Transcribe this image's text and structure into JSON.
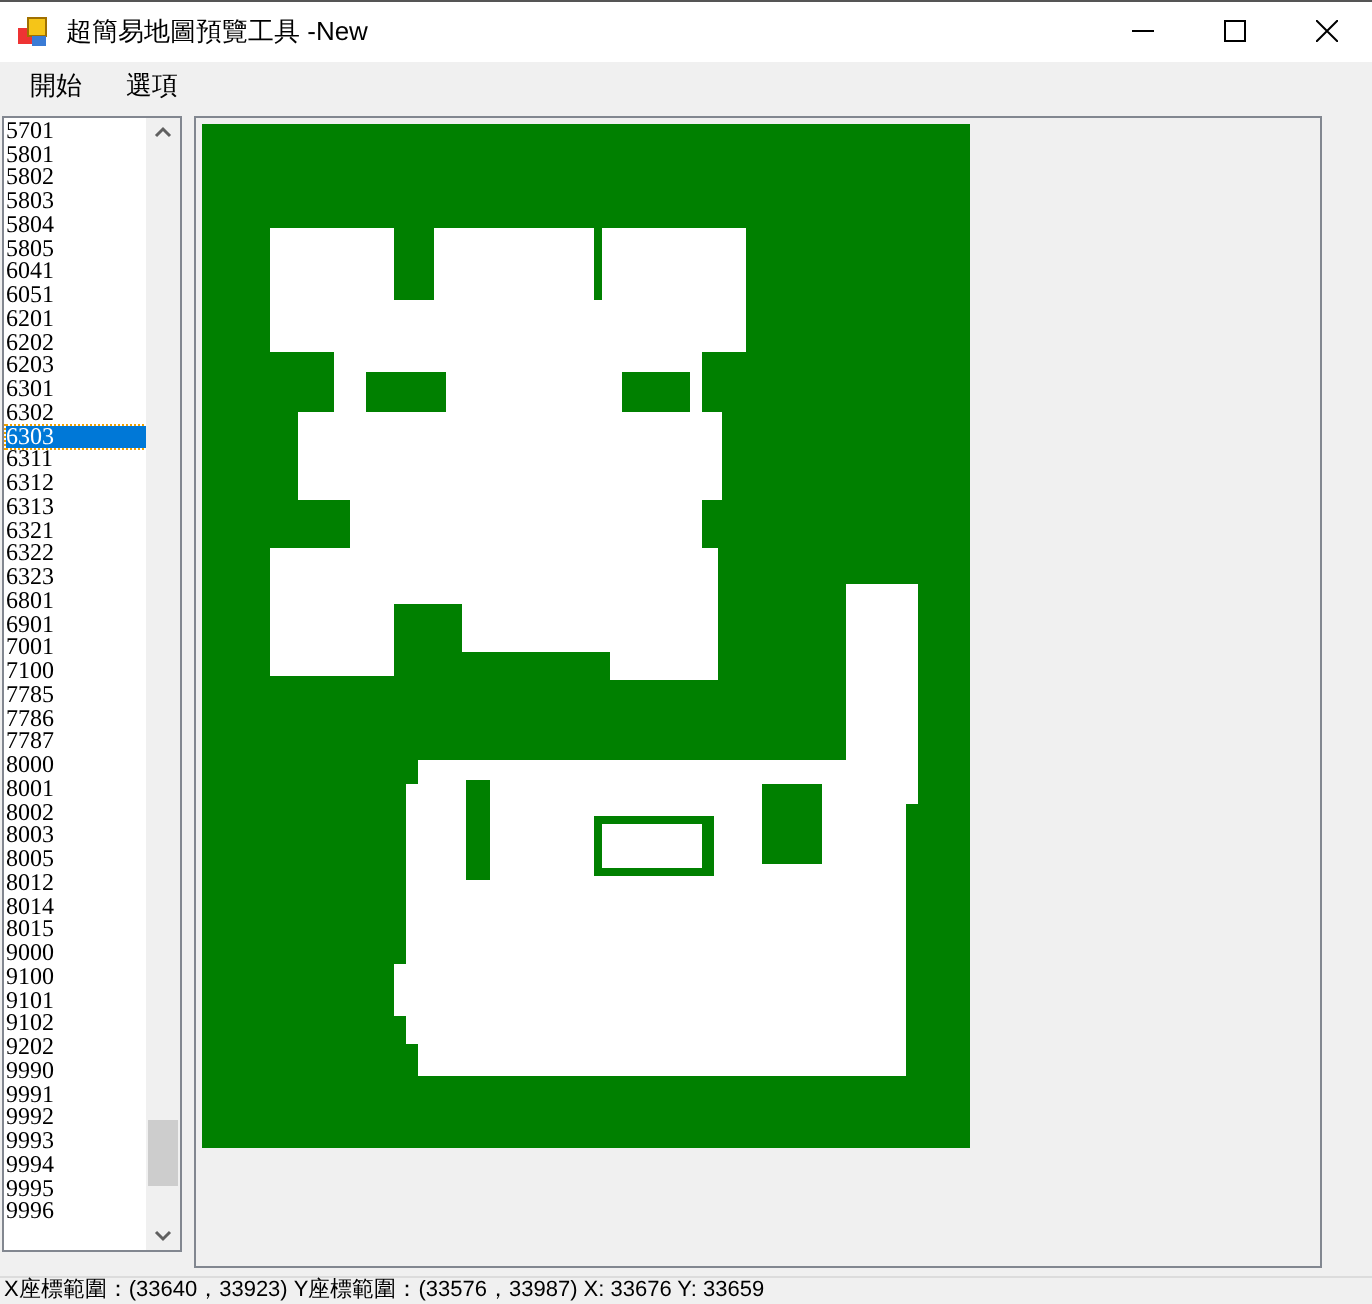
{
  "window": {
    "title": "超簡易地圖預覽工具 -New"
  },
  "menu": [
    {
      "label": "開始"
    },
    {
      "label": "選項"
    }
  ],
  "map_list": {
    "items": [
      {
        "label": "5701",
        "selected": false
      },
      {
        "label": "5801",
        "selected": false
      },
      {
        "label": "5802",
        "selected": false
      },
      {
        "label": "5803",
        "selected": false
      },
      {
        "label": "5804",
        "selected": false
      },
      {
        "label": "5805",
        "selected": false
      },
      {
        "label": "6041",
        "selected": false
      },
      {
        "label": "6051",
        "selected": false
      },
      {
        "label": "6201",
        "selected": false
      },
      {
        "label": "6202",
        "selected": false
      },
      {
        "label": "6203",
        "selected": false
      },
      {
        "label": "6301",
        "selected": false
      },
      {
        "label": "6302",
        "selected": false
      },
      {
        "label": "6303",
        "selected": true
      },
      {
        "label": "6311",
        "selected": false
      },
      {
        "label": "6312",
        "selected": false
      },
      {
        "label": "6313",
        "selected": false
      },
      {
        "label": "6321",
        "selected": false
      },
      {
        "label": "6322",
        "selected": false
      },
      {
        "label": "6323",
        "selected": false
      },
      {
        "label": "6801",
        "selected": false
      },
      {
        "label": "6901",
        "selected": false
      },
      {
        "label": "7001",
        "selected": false
      },
      {
        "label": "7100",
        "selected": false
      },
      {
        "label": "7785",
        "selected": false
      },
      {
        "label": "7786",
        "selected": false
      },
      {
        "label": "7787",
        "selected": false
      },
      {
        "label": "8000",
        "selected": false
      },
      {
        "label": "8001",
        "selected": false
      },
      {
        "label": "8002",
        "selected": false
      },
      {
        "label": "8003",
        "selected": false
      },
      {
        "label": "8005",
        "selected": false
      },
      {
        "label": "8012",
        "selected": false
      },
      {
        "label": "8014",
        "selected": false
      },
      {
        "label": "8015",
        "selected": false
      },
      {
        "label": "9000",
        "selected": false
      },
      {
        "label": "9100",
        "selected": false
      },
      {
        "label": "9101",
        "selected": false
      },
      {
        "label": "9102",
        "selected": false
      },
      {
        "label": "9202",
        "selected": false
      },
      {
        "label": "9990",
        "selected": false
      },
      {
        "label": "9991",
        "selected": false
      },
      {
        "label": "9992",
        "selected": false
      },
      {
        "label": "9993",
        "selected": false
      },
      {
        "label": "9994",
        "selected": false
      },
      {
        "label": "9995",
        "selected": false
      },
      {
        "label": "9996",
        "selected": false
      }
    ]
  },
  "status_bar": {
    "text": "X座標範圍：(33640，33923) Y座標範圍：(33576，33987)  X: 33676  Y: 33659"
  }
}
